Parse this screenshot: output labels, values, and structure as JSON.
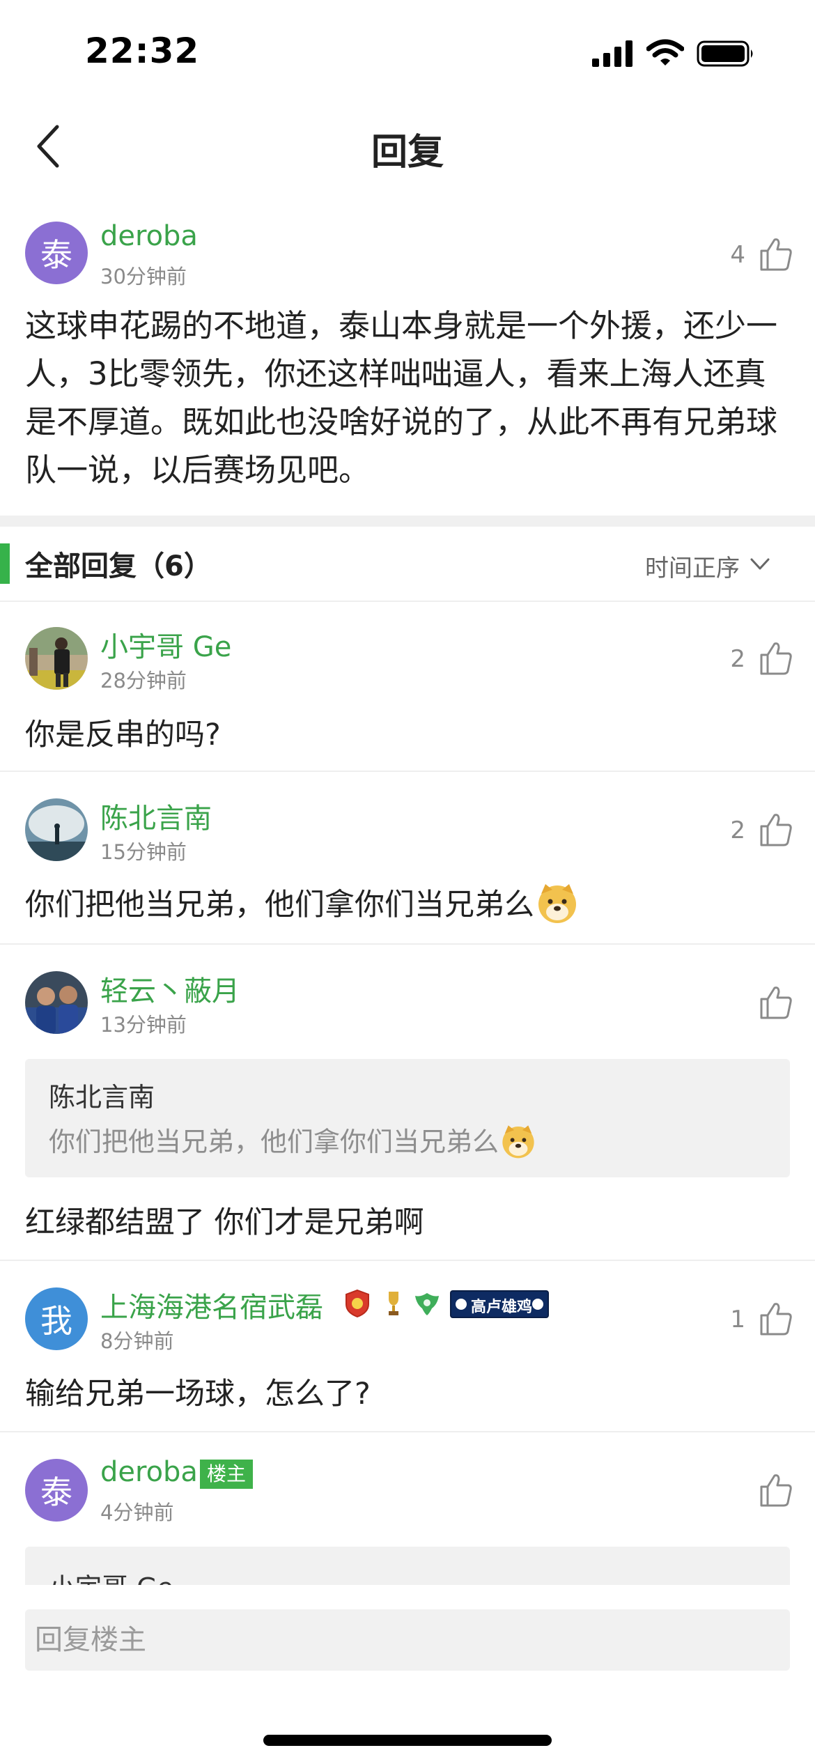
{
  "status_bar": {
    "time": "22:32"
  },
  "nav": {
    "title": "回复"
  },
  "post": {
    "avatar_char": "泰",
    "author": "deroba",
    "time": "30分钟前",
    "likes": "4",
    "content": "这球申花踢的不地道，泰山本身就是一个外援，还少一人，3比零领先，你还这样咄咄逼人，看来上海人还真是不厚道。既如此也没啥好说的了，从此不再有兄弟球队一说，以后赛场见吧。"
  },
  "replies_header": {
    "title": "全部回复（6）",
    "sort_label": "时间正序"
  },
  "replies": [
    {
      "author": "小宇哥 Ge",
      "time": "28分钟前",
      "likes": "2",
      "content": "你是反串的吗?"
    },
    {
      "author": "陈北言南",
      "time": "15分钟前",
      "likes": "2",
      "content": "你们把他当兄弟，他们拿你们当兄弟么"
    },
    {
      "author": "轻云丶蔽月",
      "time": "13分钟前",
      "likes": "",
      "quote_author": "陈北言南",
      "quote_text": "你们把他当兄弟，他们拿你们当兄弟么",
      "content": "红绿都结盟了 你们才是兄弟啊"
    },
    {
      "avatar_char": "我",
      "author": "上海海港名宿武磊",
      "time": "8分钟前",
      "likes": "1",
      "badge_banner": "高卢雄鸡",
      "content": "输给兄弟一场球，怎么了?"
    },
    {
      "avatar_char": "泰",
      "author": "deroba",
      "owner_badge": "楼主",
      "time": "4分钟前",
      "likes": "",
      "quote_author": "小宇哥 Ge"
    }
  ],
  "reply_input": {
    "placeholder": "回复楼主"
  },
  "colors": {
    "accent_green": "#3aa34a",
    "badge_green": "#3fb24a",
    "avatar_purple": "#8b6fd3",
    "avatar_blue": "#3f8fd8"
  }
}
